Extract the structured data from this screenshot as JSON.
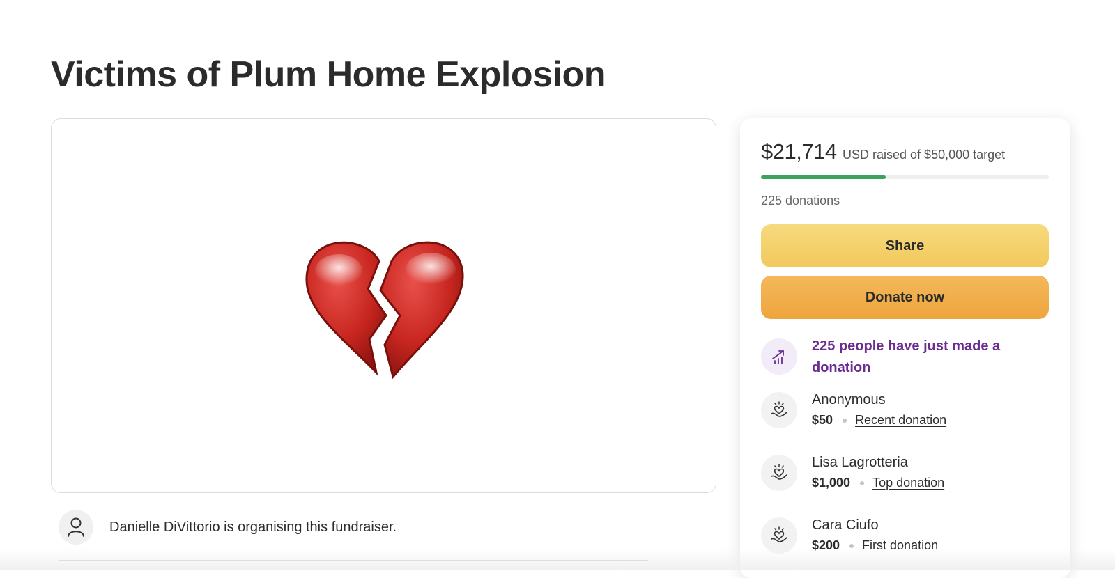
{
  "campaign": {
    "title": "Victims of Plum Home Explosion"
  },
  "organiser": {
    "text": "Danielle DiVittorio is organising this fundraiser."
  },
  "stats": {
    "amount": "$21,714",
    "amount_sub": "USD raised of $50,000 target",
    "progress_fraction": 0.434,
    "donations": "225 donations"
  },
  "buttons": {
    "share": "Share",
    "donate": "Donate now"
  },
  "trend": {
    "text": "225 people have just made a donation"
  },
  "donors": [
    {
      "name": "Anonymous",
      "amount": "$50",
      "tag": "Recent donation"
    },
    {
      "name": "Lisa Lagrotteria",
      "amount": "$1,000",
      "tag": "Top donation"
    },
    {
      "name": "Cara Ciufo",
      "amount": "$200",
      "tag": "First donation"
    }
  ],
  "icons": {
    "hero": "broken-heart-icon",
    "organiser": "user-icon",
    "trend": "trending-up-icon",
    "donor": "heart-in-hand-icon"
  },
  "colors": {
    "progress": "#3aa35c",
    "share": "#f2c95c",
    "donate": "#efa53e",
    "trend_text": "#6a2c91"
  }
}
